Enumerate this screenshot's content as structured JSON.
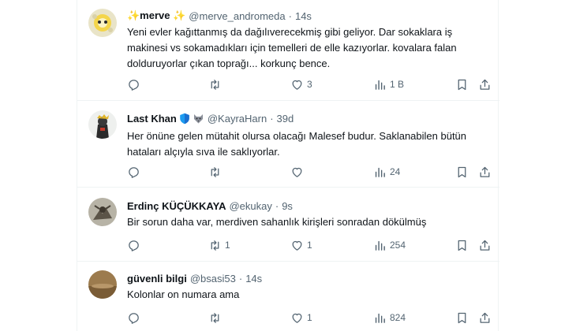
{
  "posts": [
    {
      "name": "✨merve ✨",
      "handle": "@merve_andromeda",
      "time": "14s",
      "lines": [
        "Yeni evler kağıttanmış da dağılıverecekmiş gibi geliyor.  Dar sokaklara iş",
        "makinesi vs sokamadıkları için temelleri de elle kazıyorlar. kovalara falan",
        "dolduruyorlar çıkan toprağı... korkunç bence."
      ],
      "replies": "",
      "reposts": "",
      "likes": "3",
      "views": "1 B"
    },
    {
      "name": "Last Khan",
      "handle": "@KayraHarn",
      "time": "39d",
      "lines": [
        "Her önüne gelen mütahit olursa olacağı Malesef budur. Saklanabilen bütün",
        "hataları alçıyla sıva ile saklıyorlar."
      ],
      "replies": "",
      "reposts": "",
      "likes": "",
      "views": "24"
    },
    {
      "name": "Erdinç KÜÇÜKKAYA",
      "handle": "@ekukay",
      "time": "9s",
      "lines": [
        "Bir sorun daha var, merdiven sahanlık kirişleri  sonradan dökülmüş"
      ],
      "replies": "",
      "reposts": "1",
      "likes": "1",
      "views": "254"
    },
    {
      "name": "güvenli bilgi",
      "handle": "@bsasi53",
      "time": "14s",
      "lines": [
        "Kolonlar on numara ama"
      ],
      "replies": "",
      "reposts": "",
      "likes": "1",
      "views": "824"
    }
  ],
  "separator": "·",
  "colors": {
    "text": "#0f1419",
    "muted": "#536471",
    "border": "#eff3f4",
    "shield": "#1d9bf0"
  }
}
